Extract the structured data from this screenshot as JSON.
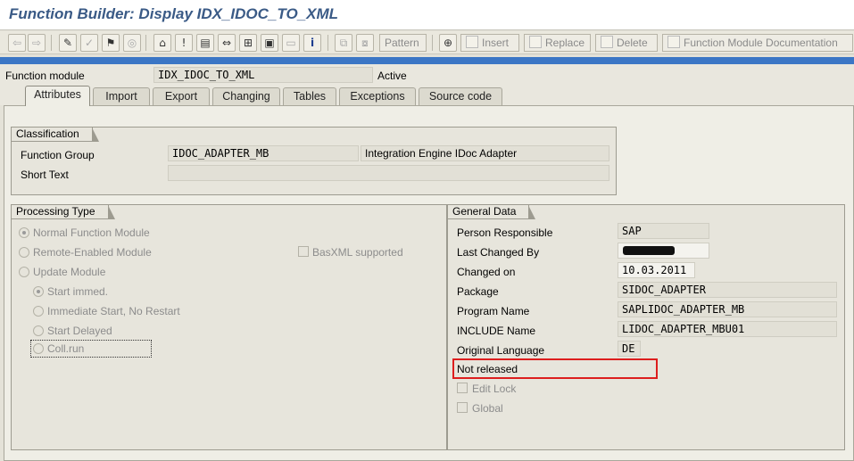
{
  "window": {
    "title": "Function Builder: Display IDX_IDOC_TO_XML"
  },
  "toolbar": {
    "icons": [
      "back-icon",
      "forward-icon",
      "other-object-icon",
      "check-icon",
      "activate-icon",
      "where-used-icon",
      "display-object-list-icon",
      "navigation-window-icon",
      "enhance-icon",
      "info-icon"
    ],
    "pattern_label": "Pattern",
    "insert_label": "Insert",
    "replace_label": "Replace",
    "delete_label": "Delete",
    "documentation_label": "Function Module Documentation"
  },
  "header": {
    "function_module_label": "Function module",
    "function_module_value": "IDX_IDOC_TO_XML",
    "status": "Active"
  },
  "tabs": [
    {
      "label": "Attributes",
      "active": true
    },
    {
      "label": "Import"
    },
    {
      "label": "Export"
    },
    {
      "label": "Changing"
    },
    {
      "label": "Tables"
    },
    {
      "label": "Exceptions"
    },
    {
      "label": "Source code"
    }
  ],
  "classification": {
    "title": "Classification",
    "function_group_label": "Function Group",
    "function_group_value": "IDOC_ADAPTER_MB",
    "function_group_desc": "Integration Engine IDoc Adapter",
    "short_text_label": "Short Text",
    "short_text_value": ""
  },
  "processing": {
    "title": "Processing Type",
    "normal": "Normal Function Module",
    "remote": "Remote-Enabled Module",
    "basxml": "BasXML supported",
    "update": "Update Module",
    "start_immed": "Start immed.",
    "immediate_no_restart": "Immediate Start, No Restart",
    "start_delayed": "Start Delayed",
    "coll_run": "Coll.run"
  },
  "general": {
    "title": "General Data",
    "person_label": "Person Responsible",
    "person_value": "SAP",
    "last_changed_label": "Last Changed By",
    "last_changed_value": "",
    "changed_on_label": "Changed on",
    "changed_on_value": "10.03.2011",
    "package_label": "Package",
    "package_value": "SIDOC_ADAPTER",
    "program_label": "Program Name",
    "program_value": "SAPLIDOC_ADAPTER_MB",
    "include_label": "INCLUDE Name",
    "include_value": "LIDOC_ADAPTER_MBU01",
    "language_label": "Original Language",
    "language_value": "DE",
    "release_status": "Not released",
    "edit_lock": "Edit Lock",
    "global": "Global"
  },
  "colors": {
    "title_blue": "#3a5a86",
    "band_blue": "#3b76c5",
    "highlight_red": "#dd1e1e"
  }
}
